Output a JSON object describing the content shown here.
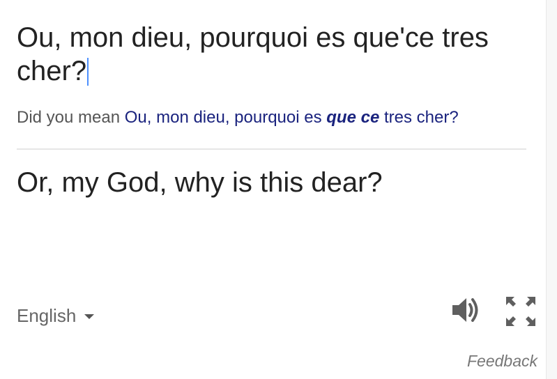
{
  "source": {
    "text": "Ou, mon dieu, pourquoi es que'ce tres cher?"
  },
  "did_you_mean": {
    "prefix": "Did you mean",
    "suggestion_before": "Ou, mon dieu, pourquoi es ",
    "suggestion_emphasis": "que ce",
    "suggestion_after": " tres cher?"
  },
  "translation": {
    "text": "Or, my God, why is this dear?"
  },
  "footer": {
    "language": "English",
    "feedback": "Feedback"
  },
  "icons": {
    "speaker": "speaker-icon",
    "expand": "fullscreen-icon",
    "dropdown": "caret-down-icon"
  },
  "colors": {
    "suggestion": "#1a237e",
    "text": "#222222",
    "muted": "#666666",
    "caret": "#4d90fe"
  }
}
